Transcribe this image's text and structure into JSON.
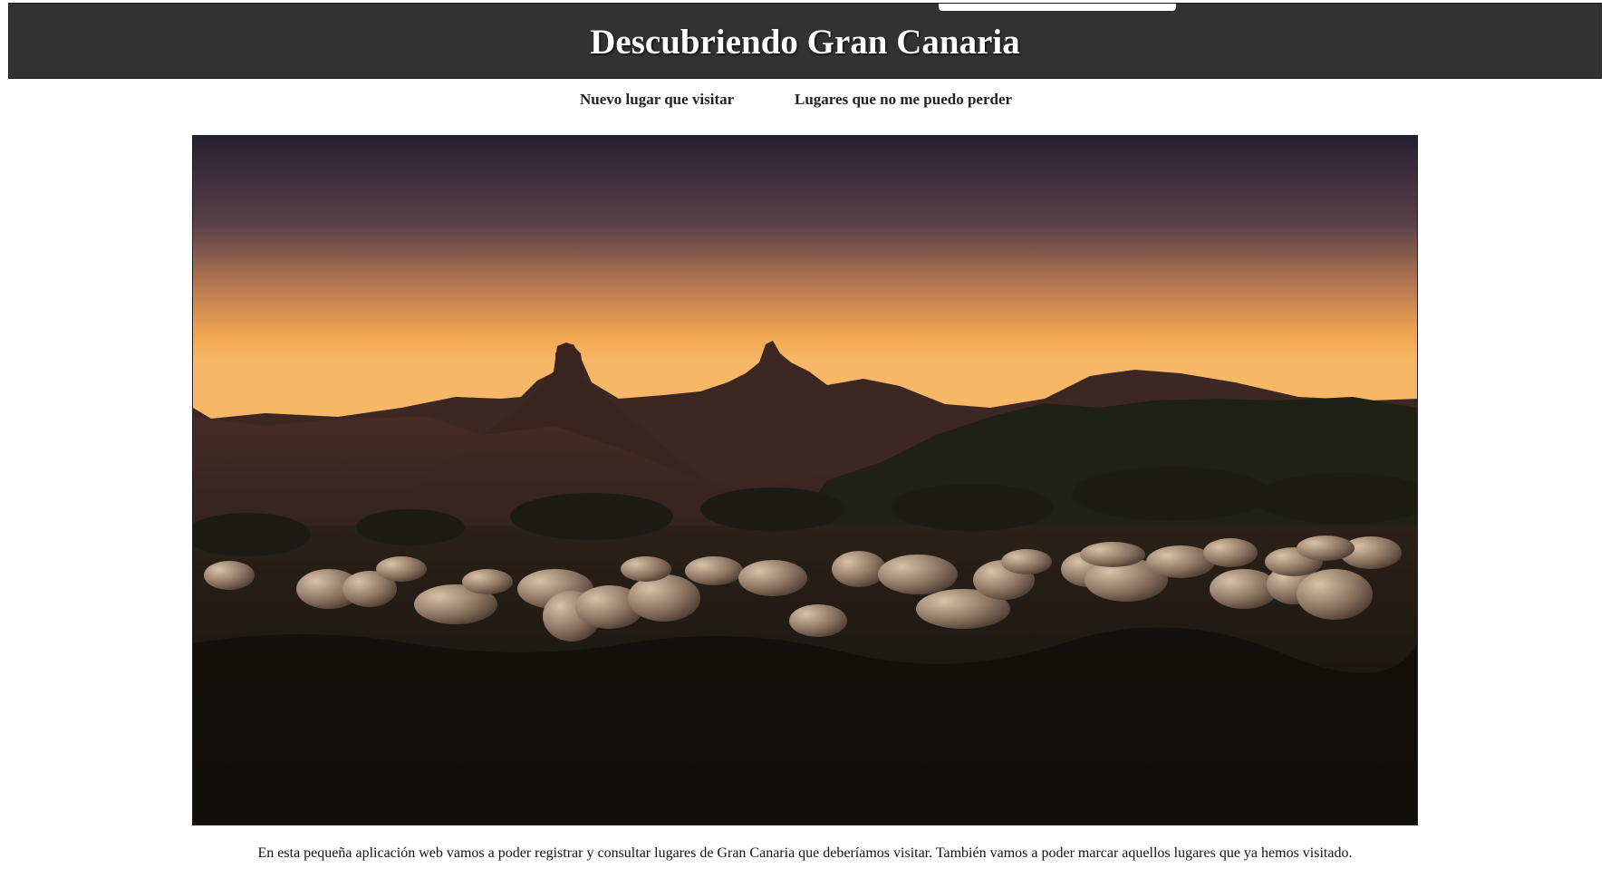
{
  "header": {
    "title": "Descubriendo Gran Canaria"
  },
  "nav": {
    "items": [
      {
        "label": "Nuevo lugar que visitar"
      },
      {
        "label": "Lugares que no me puedo perder"
      }
    ]
  },
  "hero": {
    "image_subject": "landscape-photo",
    "colors": {
      "sky_top": "#2a2230",
      "sky_glow": "#f2a650",
      "mountains": "#3a2522",
      "ground": "#151210"
    }
  },
  "main": {
    "intro_text": "En esta pequeña aplicación web vamos a poder registrar y consultar lugares de Gran Canaria que deberíamos visitar. También vamos a poder marcar aquellos lugares que ya hemos visitado."
  },
  "colors": {
    "header_bg": "#323232",
    "title_text": "#ffffff",
    "page_bg": "#ffffff",
    "body_text": "#111111"
  }
}
